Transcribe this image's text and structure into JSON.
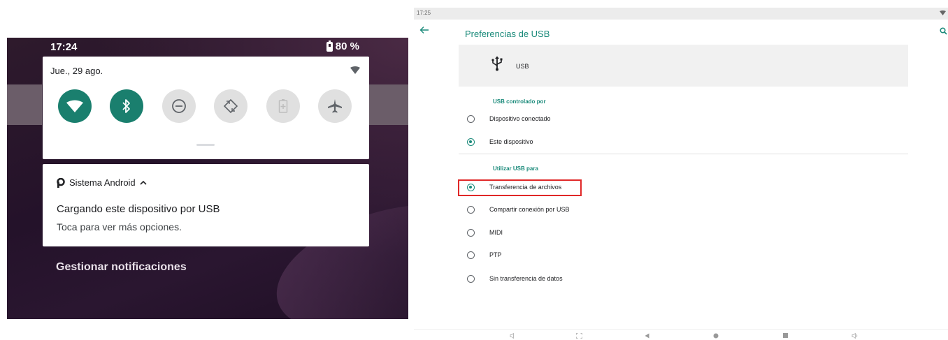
{
  "shade": {
    "status_time": "17:24",
    "battery_percent": "80 %",
    "date": "Jue., 29 ago.",
    "tiles": [
      {
        "icon": "wifi-icon",
        "active": true
      },
      {
        "icon": "bluetooth-icon",
        "active": true
      },
      {
        "icon": "do-not-disturb-icon",
        "active": false
      },
      {
        "icon": "auto-rotate-icon",
        "active": false
      },
      {
        "icon": "battery-saver-icon",
        "active": false
      },
      {
        "icon": "airplane-mode-icon",
        "active": false
      }
    ],
    "notification": {
      "app": "Sistema Android",
      "title": "Cargando este dispositivo por USB",
      "text": "Toca para ver más opciones."
    },
    "manage_label": "Gestionar notificaciones",
    "colors": {
      "tile_on": "#1a7f6e",
      "tile_off": "#e0e0e0"
    }
  },
  "settings": {
    "status_time": "17:25",
    "title": "Preferencias de USB",
    "usb_label": "USB",
    "section_controlled_by": "USB controlado por",
    "controlled_by_options": [
      {
        "label": "Dispositivo conectado",
        "selected": false
      },
      {
        "label": "Este dispositivo",
        "selected": true
      }
    ],
    "section_use_for": "Utilizar USB para",
    "use_for_options": [
      {
        "label": "Transferencia de archivos",
        "selected": true
      },
      {
        "label": "Compartir conexión por USB",
        "selected": false
      },
      {
        "label": "MIDI",
        "selected": false
      },
      {
        "label": "PTP",
        "selected": false
      },
      {
        "label": "Sin transferencia de datos",
        "selected": false
      }
    ],
    "accent_color": "#1a8a7a",
    "highlight_color": "#e02828"
  }
}
